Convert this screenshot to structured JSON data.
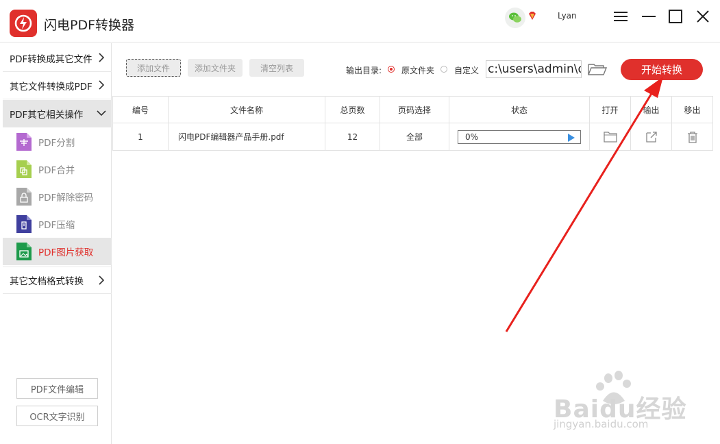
{
  "app": {
    "title": "闪电PDF转换器",
    "user": "Lyan",
    "accent": "#e0302c"
  },
  "sidebar": {
    "categories": [
      {
        "label": "PDF转换成其它文件"
      },
      {
        "label": "其它文件转换成PDF"
      },
      {
        "label": "PDF其它相关操作"
      },
      {
        "label": "其它文档格式转换"
      }
    ],
    "subitems": [
      {
        "label": "PDF分割",
        "color": "#b46ad0"
      },
      {
        "label": "PDF合并",
        "color": "#a6cf4f"
      },
      {
        "label": "PDF解除密码",
        "color": "#a8a8a8"
      },
      {
        "label": "PDF压缩",
        "color": "#3f3f9e"
      },
      {
        "label": "PDF图片获取",
        "color": "#1d9a4b"
      }
    ],
    "bottom_buttons": [
      {
        "label": "PDF文件编辑"
      },
      {
        "label": "OCR文字识别"
      }
    ]
  },
  "toolbar": {
    "add_file": "添加文件",
    "add_folder": "添加文件夹",
    "clear_list": "清空列表",
    "output_label": "输出目录:",
    "option_original": "原文件夹",
    "option_custom": "自定义",
    "path_value": "c:\\users\\admin\\d",
    "start": "开始转换"
  },
  "table": {
    "headers": [
      "编号",
      "文件名称",
      "总页数",
      "页码选择",
      "状态",
      "打开",
      "输出",
      "移出"
    ],
    "rows": [
      {
        "index": "1",
        "name": "闪电PDF编辑器产品手册.pdf",
        "pages": "12",
        "range": "全部",
        "status": "0%",
        "progress": 0
      }
    ]
  },
  "watermark": {
    "logo_text": "Baidu经验",
    "url": "jingyan.baidu.com"
  }
}
